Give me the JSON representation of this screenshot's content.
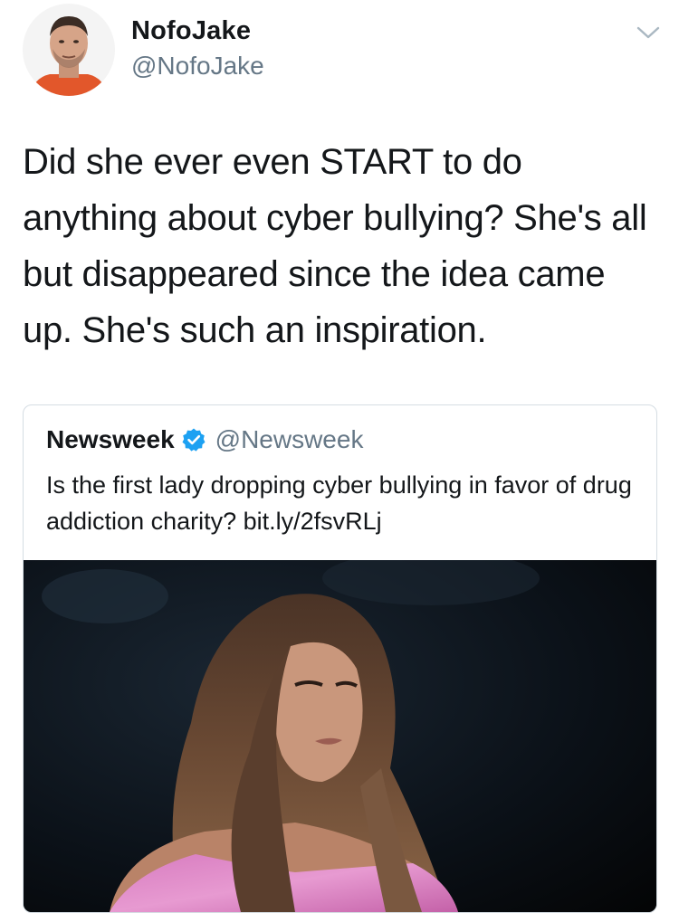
{
  "tweet": {
    "display_name": "NofoJake",
    "handle": "@NofoJake",
    "text": "Did she ever even START to do anything about cyber bullying? She's all but disappeared since the idea came up. She's such an inspiration.",
    "menu_icon": "chevron-down-icon"
  },
  "quoted_tweet": {
    "display_name": "Newsweek",
    "verified": true,
    "verified_icon": "verified-badge-icon",
    "handle": "@Newsweek",
    "text": "Is the first lady dropping cyber bullying in favor of drug addiction charity? bit.ly/2fsvRLj"
  },
  "colors": {
    "text_primary": "#14171a",
    "text_secondary": "#657786",
    "verified_blue": "#1da1f2",
    "card_border": "#d5dde3"
  }
}
